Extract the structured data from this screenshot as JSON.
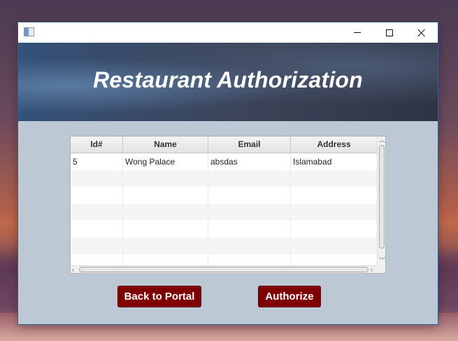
{
  "window": {
    "title": "",
    "controls": {
      "minimize": "minimize-icon",
      "maximize": "maximize-icon",
      "close": "close-icon"
    }
  },
  "banner": {
    "title": "Restaurant Authorization"
  },
  "table": {
    "columns": [
      "Id#",
      "Name",
      "Email",
      "Address"
    ],
    "rows": [
      {
        "id": "5",
        "name": "Wong Palace",
        "email": "absdas",
        "address": "Islamabad"
      }
    ]
  },
  "buttons": {
    "back_label": "Back to Portal",
    "authorize_label": "Authorize"
  },
  "colors": {
    "button_bg": "#7f0000",
    "content_bg": "#bcc8d3"
  }
}
